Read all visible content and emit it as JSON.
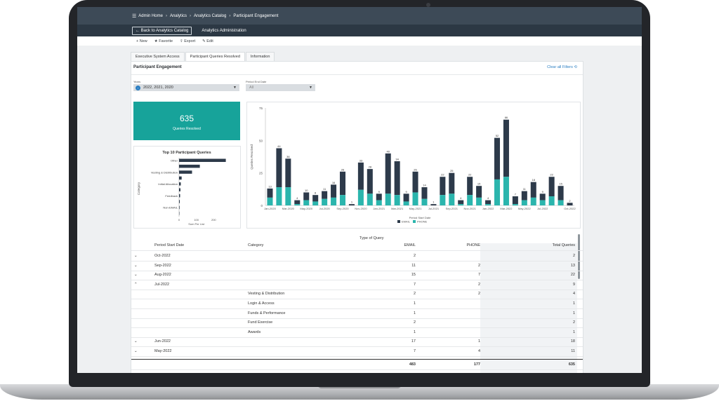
{
  "breadcrumbs": [
    "Admin Home",
    "Analytics",
    "Analytics Catalog",
    "Participant Engagement"
  ],
  "subbar": {
    "back_label": "← Back to Analytics Catalog",
    "admin_label": "Analytics Administration"
  },
  "toolbar": {
    "new": "+ New",
    "favorite": "★ Favorite",
    "export": "⇪ Export",
    "edit": "✎ Edit"
  },
  "tabs": [
    "Executive System Access",
    "Participant Queries Resolved",
    "Information"
  ],
  "page_title": "Participant Engagement",
  "clear_filters": "Clear all Filters",
  "filters": {
    "years_label": "Years",
    "years_value": "2022, 2021, 2020",
    "period_label": "Period End Date",
    "period_value": "All"
  },
  "kpi": {
    "value": "635",
    "label": "Queries Resolved"
  },
  "colors": {
    "teal": "#2bb5ad",
    "navy": "#2d3a4a",
    "topbar": "#3d4a57"
  },
  "chart_data": [
    {
      "type": "bar",
      "orientation": "horizontal",
      "title": "Top 10 Participant Queries",
      "ylabel": "Category",
      "xlabel": "Sum Per List",
      "categories": [
        "Other",
        "",
        "Vesting & Distribution",
        "",
        "Initial Allocation",
        "",
        "Feedback",
        "",
        "Non-EMAIL",
        ""
      ],
      "values": [
        270,
        120,
        75,
        15,
        10,
        8,
        6,
        4,
        3,
        2
      ],
      "xticks": [
        "0",
        "100",
        "200"
      ],
      "xlim": [
        0,
        300
      ]
    },
    {
      "type": "bar",
      "stacked": true,
      "ylabel": "Queries Resolved",
      "xlabel": "Period Start Date",
      "ylim": [
        0,
        75
      ],
      "yticks": [
        "0",
        "25",
        "50",
        "75"
      ],
      "xticks": [
        "Jan-2020",
        "Mar-2020",
        "May-2020",
        "Jul-2020",
        "Sep-2020",
        "Nov-2020",
        "Jan-2021",
        "Mar-2021",
        "May-2021",
        "Jul-2021",
        "Sep-2021",
        "Nov-2021",
        "Jan-2022",
        "Mar-2022",
        "May-2022",
        "Jul-2022",
        "Oct-2022"
      ],
      "totals_labels": [
        "13",
        "44",
        "36",
        "4",
        "10",
        "8",
        "11",
        "16",
        "26",
        "1",
        "33",
        "28",
        "9",
        "40",
        "34",
        "9",
        "26",
        "14",
        "1",
        "22",
        "25",
        "4",
        "22",
        "15",
        "4",
        "52",
        "66",
        "7",
        "11",
        "18",
        "9",
        "22",
        "15",
        "2"
      ],
      "series": [
        {
          "name": "EMAIL",
          "values": [
            7,
            30,
            22,
            3,
            6,
            5,
            6,
            10,
            18,
            1,
            21,
            19,
            5,
            31,
            26,
            6,
            16,
            9,
            1,
            14,
            16,
            3,
            14,
            9,
            3,
            32,
            44,
            6,
            7,
            12,
            5,
            15,
            11,
            2
          ]
        },
        {
          "name": "PHONE",
          "values": [
            6,
            14,
            14,
            1,
            4,
            3,
            5,
            6,
            8,
            0,
            12,
            9,
            4,
            9,
            8,
            3,
            10,
            5,
            0,
            8,
            9,
            1,
            8,
            6,
            1,
            20,
            22,
            1,
            4,
            6,
            4,
            7,
            4,
            0
          ]
        }
      ],
      "legend": "bottom"
    }
  ],
  "table": {
    "group_header": "Type of Query",
    "columns": [
      "Period Start Date",
      "Category",
      "EMAIL",
      "PHONE",
      "Total Queries"
    ],
    "rows": [
      {
        "toggle": "⌄",
        "period": "Oct-2022",
        "category": "",
        "email": "2",
        "phone": "",
        "total": "2"
      },
      {
        "toggle": "⌄",
        "period": "Sep-2022",
        "category": "",
        "email": "11",
        "phone": "2",
        "total": "13"
      },
      {
        "toggle": "⌄",
        "period": "Aug-2022",
        "category": "",
        "email": "15",
        "phone": "7",
        "total": "22"
      },
      {
        "toggle": "⌃",
        "period": "Jul-2022",
        "category": "",
        "email": "7",
        "phone": "2",
        "total": "9"
      },
      {
        "toggle": "",
        "period": "",
        "category": "Vesting & Distribution",
        "email": "2",
        "phone": "2",
        "total": "4"
      },
      {
        "toggle": "",
        "period": "",
        "category": "Login & Access",
        "email": "1",
        "phone": "",
        "total": "1"
      },
      {
        "toggle": "",
        "period": "",
        "category": "Funds & Performance",
        "email": "1",
        "phone": "",
        "total": "1"
      },
      {
        "toggle": "",
        "period": "",
        "category": "Fund Exercise",
        "email": "2",
        "phone": "",
        "total": "2"
      },
      {
        "toggle": "",
        "period": "",
        "category": "Awards",
        "email": "1",
        "phone": "",
        "total": "1"
      },
      {
        "toggle": "⌄",
        "period": "Jun-2022",
        "category": "",
        "email": "17",
        "phone": "1",
        "total": "18"
      },
      {
        "toggle": "⌄",
        "period": "May-2022",
        "category": "",
        "email": "7",
        "phone": "4",
        "total": "11"
      }
    ],
    "totals": {
      "email": "483",
      "phone": "177",
      "total": "635"
    }
  }
}
